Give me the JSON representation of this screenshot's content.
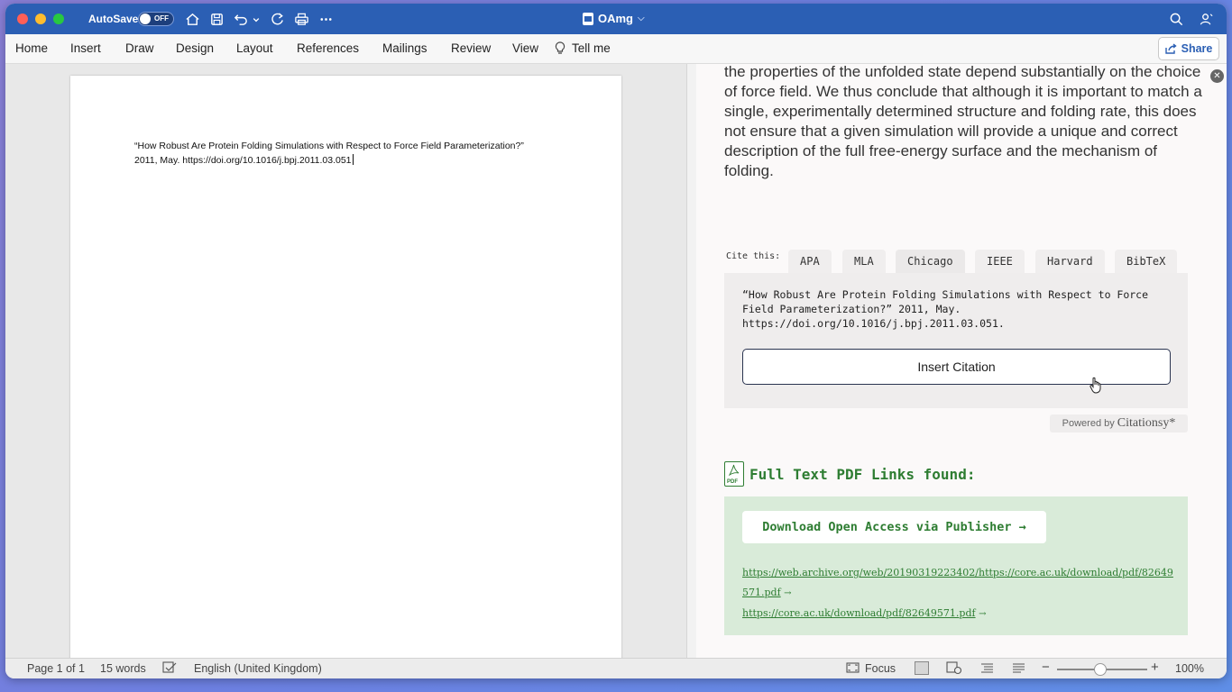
{
  "titlebar": {
    "autosave_label": "AutoSave",
    "autosave_state": "OFF",
    "document_title": "OAmg"
  },
  "ribbon": {
    "tabs": [
      "Home",
      "Insert",
      "Draw",
      "Design",
      "Layout",
      "References",
      "Mailings",
      "Review",
      "View",
      "Tell me"
    ],
    "share_label": "Share"
  },
  "document": {
    "citation_line1": "“How Robust Are Protein Folding Simulations with Respect to Force Field Parameterization?”",
    "citation_line2": "2011, May. https://doi.org/10.1016/j.bpj.2011.03.051"
  },
  "panel": {
    "abstract_text": "the properties of the unfolded state depend substantially on the choice of force field. We thus conclude that although it is important to match a single, experimentally determined structure and folding rate, this does not ensure that a given simulation will provide a unique and correct description of the full free-energy surface and the mechanism of folding.",
    "cite_label": "Cite this:",
    "cite_tabs": [
      "APA",
      "MLA",
      "Chicago",
      "IEEE",
      "Harvard",
      "BibTeX"
    ],
    "active_cite_tab": "Chicago",
    "citation_text": "“How Robust Are Protein Folding Simulations with Respect to Force Field Parameterization?” 2011, May. https://doi.org/10.1016/j.bpj.2011.03.051.",
    "insert_button": "Insert Citation",
    "powered_by": "Powered by",
    "powered_brand": "Citationsy*",
    "pdf_heading": "Full Text PDF Links found:",
    "pdf_icon_label": "PDF",
    "download_button": "Download Open Access via Publisher →",
    "links": [
      "https://web.archive.org/web/20190319223402/https://core.ac.uk/download/pdf/82649571.pdf",
      "https://core.ac.uk/download/pdf/82649571.pdf"
    ],
    "link_arrow": "→"
  },
  "statusbar": {
    "page": "Page 1 of 1",
    "words": "15 words",
    "language": "English (United Kingdom)",
    "focus": "Focus",
    "zoom": "100%",
    "zoom_level_percent": 100
  },
  "colors": {
    "titlebar": "#2b5fb4",
    "accent_green": "#2e7d32",
    "links_bg": "#d9ebd9"
  }
}
